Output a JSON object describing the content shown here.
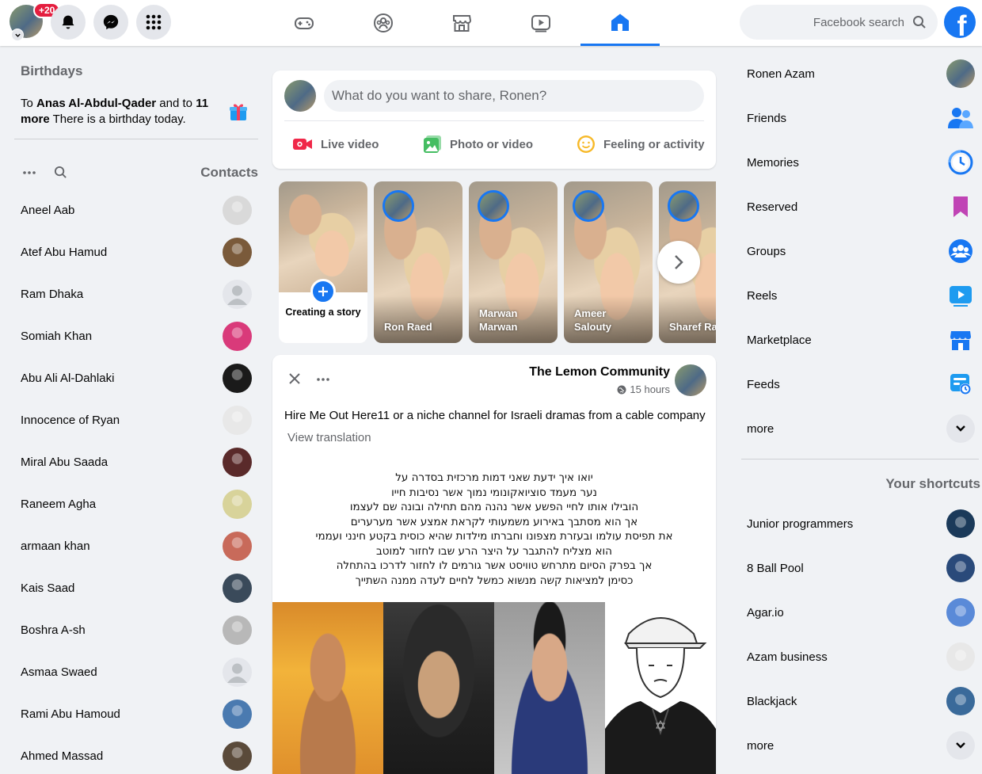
{
  "topbar": {
    "notification_count": "+20",
    "search_placeholder": "Facebook search",
    "logo_letter": "f",
    "nav_tabs": [
      {
        "icon": "gaming-icon",
        "active": false
      },
      {
        "icon": "groups-icon",
        "active": false
      },
      {
        "icon": "marketplace-icon",
        "active": false
      },
      {
        "icon": "watch-icon",
        "active": false
      },
      {
        "icon": "home-icon",
        "active": true
      }
    ],
    "accent_color": "#1877f2"
  },
  "birthdays": {
    "title": "Birthdays",
    "prefix": "To ",
    "name": "Anas Al-Abdul-Qader",
    "middle": " and to ",
    "more": "11 more",
    "suffix": " There is a birthday today."
  },
  "contacts": {
    "title": "Contacts",
    "items": [
      {
        "name": "Aneel Aab",
        "avatar_color": "#d9d9d9"
      },
      {
        "name": "Atef Abu Hamud",
        "avatar_color": "#7a5a3a"
      },
      {
        "name": "Ram Dhaka",
        "avatar_color": "#bcc0c4"
      },
      {
        "name": "Somiah Khan",
        "avatar_color": "#d93a7a"
      },
      {
        "name": "Abu Ali Al-Dahlaki",
        "avatar_color": "#1a1a1a"
      },
      {
        "name": "Innocence of Ryan",
        "avatar_color": "#e8e8e8"
      },
      {
        "name": "Miral Abu Saada",
        "avatar_color": "#5a2a2a"
      },
      {
        "name": "Raneem Agha",
        "avatar_color": "#d8d39a"
      },
      {
        "name": "armaan khan",
        "avatar_color": "#c86a5a"
      },
      {
        "name": "Kais Saad",
        "avatar_color": "#3a4a5a"
      },
      {
        "name": "Boshra A-sh",
        "avatar_color": "#b8b8b8"
      },
      {
        "name": "Asmaa Swaed",
        "avatar_color": "#bcc0c4"
      },
      {
        "name": "Rami Abu Hamoud",
        "avatar_color": "#4a7ab0"
      },
      {
        "name": "Ahmed Massad",
        "avatar_color": "#5a4a3a"
      }
    ]
  },
  "composer": {
    "placeholder": "What do you want to share, Ronen?",
    "actions": [
      {
        "label": "Live video",
        "icon": "live-video-icon",
        "color": "#f02849"
      },
      {
        "label": "Photo or video",
        "icon": "photo-icon",
        "color": "#45bd62"
      },
      {
        "label": "Feeling or activity",
        "icon": "feeling-icon",
        "color": "#f7b928"
      }
    ]
  },
  "stories": {
    "create_label": "Creating a story",
    "items": [
      {
        "name": "Ron Raed"
      },
      {
        "name": "Marwan Marwan"
      },
      {
        "name": "Ameer Salouty"
      },
      {
        "name": "Sharef Ra"
      }
    ]
  },
  "post": {
    "author": "The Lemon Community",
    "time": "15 hours",
    "text": "Hire Me Out Here11 or a niche channel for Israeli dramas from a cable company",
    "translate": "View translation",
    "hebrew_lines": [
      "יואו איך ידעת שאני דמות מרכזית בסדרה על",
      "נער מעמד סוציואקונומי נמוך אשר נסיבות חייו",
      "הובילו אותו לחיי הפשע אשר נהנה מהם תחילה ובונה שם לעצמו",
      "אך הוא מסתבך באירוע משמעותי לקראת אמצע אשר מערערים",
      "את תפיסת עולמו ובעזרת מצפונו וחברתו מילדות שהיא כוסית בקטע חינני ועממי",
      "הוא מצליח להתגבר על היצר הרע שבו לחזור למוטב",
      "אך בפרק הסיום מתרחש טוויסט אשר גורמים לו לחזור לדרכו בהתחלה",
      "כסימן למציאות קשה מנשוא כמשל לחיים לעדה ממנה השתייך"
    ]
  },
  "right_menu": {
    "items": [
      {
        "label": "Ronen Azam",
        "icon": "profile-avatar"
      },
      {
        "label": "Friends",
        "icon": "friends-icon"
      },
      {
        "label": "Memories",
        "icon": "memories-icon"
      },
      {
        "label": "Reserved",
        "icon": "saved-icon"
      },
      {
        "label": "Groups",
        "icon": "groups-icon"
      },
      {
        "label": "Reels",
        "icon": "reels-icon"
      },
      {
        "label": "Marketplace",
        "icon": "marketplace-icon"
      },
      {
        "label": "Feeds",
        "icon": "feeds-icon"
      },
      {
        "label": "more",
        "icon": "chevron-down-icon"
      }
    ],
    "shortcuts_title": "Your shortcuts",
    "shortcuts": [
      {
        "label": "Junior programmers",
        "avatar_color": "#1b3a5a"
      },
      {
        "label": "8 Ball Pool",
        "avatar_color": "#2a4a7a"
      },
      {
        "label": "Agar.io",
        "avatar_color": "#5a8ad8"
      },
      {
        "label": "Azam business",
        "avatar_color": "#e8e8e8"
      },
      {
        "label": "Blackjack",
        "avatar_color": "#3a6a9a"
      },
      {
        "label": "more",
        "avatar_color": ""
      }
    ]
  }
}
